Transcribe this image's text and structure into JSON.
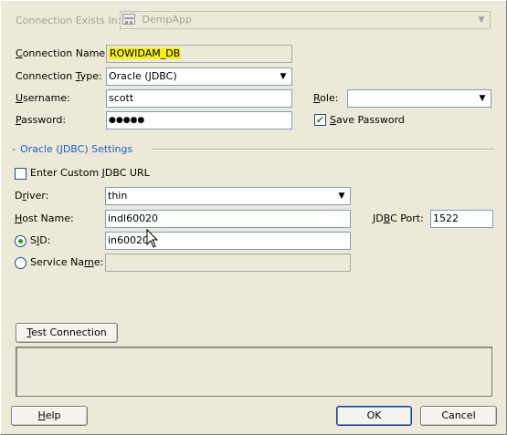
{
  "connection_exists_in": {
    "label": "Connection Exists In:",
    "value": "DempApp",
    "icon": "project-icon"
  },
  "connection_name": {
    "label": "Connection Name:",
    "value": "ROWIDAM_DB"
  },
  "connection_type": {
    "label": "Connection Type:",
    "value": "Oracle (JDBC)"
  },
  "username": {
    "label": "Username:",
    "value": "scott"
  },
  "password": {
    "label": "Password:",
    "value": "●●●●●"
  },
  "role": {
    "label": "Role:",
    "value": ""
  },
  "save_password": {
    "label": "Save Password",
    "checked": true
  },
  "section": {
    "prefix": "-",
    "title": "Oracle (JDBC) Settings"
  },
  "custom_url": {
    "label": "Enter Custom JDBC URL",
    "checked": false
  },
  "driver": {
    "label": "Driver:",
    "value": "thin"
  },
  "host_name": {
    "label": "Host Name:",
    "value": "indl60020"
  },
  "jdbc_port": {
    "label": "JDBC Port:",
    "value": "1522"
  },
  "sid": {
    "label": "SID:",
    "value": "in60020",
    "selected": true
  },
  "service_name": {
    "label": "Service Name:",
    "value": "",
    "selected": false
  },
  "test_connection": {
    "label": "Test Connection",
    "status_text": ""
  },
  "buttons": {
    "help": "Help",
    "ok": "OK",
    "cancel": "Cancel"
  },
  "colors": {
    "highlight": "#F5F021",
    "section_title": "#1F5FBF",
    "check_mark": "#21A121"
  }
}
